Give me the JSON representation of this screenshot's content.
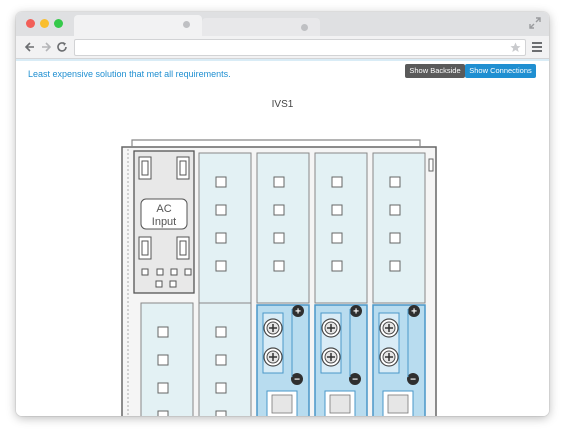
{
  "browser": {
    "tab_title": "",
    "url": "",
    "colors": {
      "close": "#f25f58",
      "minimize": "#f9be2d",
      "maximize": "#35c94a"
    },
    "icons": [
      "back-arrow-icon",
      "forward-arrow-icon",
      "reload-icon",
      "star-icon",
      "menu-icon",
      "fullscreen-icon"
    ]
  },
  "page": {
    "message": "Least expensive solution that met all requirements.",
    "show_backside_label": "Show Backside",
    "show_connections_label": "Show Connections",
    "title": "IVS1"
  },
  "rack": {
    "ac_input_line1": "AC",
    "ac_input_line2": "Input",
    "plus_symbol": "+",
    "minus_symbol": "−",
    "colors": {
      "card_fill": "#e3f1f4",
      "supply_fill": "#b8dcef",
      "supply_stroke": "#4a97c8",
      "button_dark": "#5a5a5a",
      "button_blue": "#1f8fd1",
      "message_blue": "#1f8fd1"
    }
  }
}
